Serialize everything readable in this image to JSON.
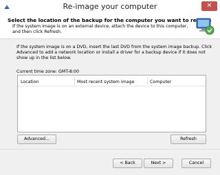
{
  "window": {
    "title": "Re-image your computer",
    "close_glyph": "✕"
  },
  "header": {
    "title": "Select the location of the backup for the computer you want to restore",
    "subtitle": "If the system image is on an external device, attach the device to this computer, and then click Refresh.",
    "icon": "computer-disk-icon"
  },
  "body": {
    "description": "If the system image is on a DVD, insert the last DVD from the system image backup. Click Advanced to add a network location or install a driver for a backup device if it does not show up in the list below.",
    "timezone": "Current time zone: GMT-8:00"
  },
  "table": {
    "columns": [
      "Location",
      "Most recent system image",
      "Computer"
    ],
    "rows": []
  },
  "buttons": {
    "advanced": "Advanced...",
    "refresh": "Refresh",
    "back": "< Back",
    "next": "Next >",
    "cancel": "Cancel"
  },
  "colors": {
    "close_button": "#c7504a",
    "body_background": "#f0f0f0"
  }
}
